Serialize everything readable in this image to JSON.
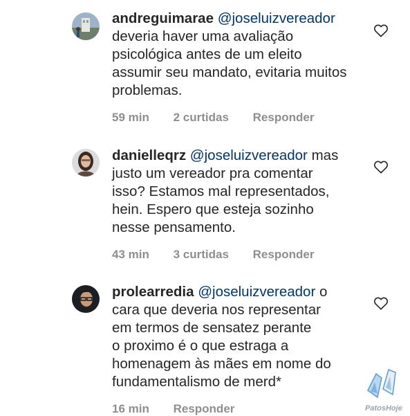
{
  "comments": [
    {
      "username": "andreguimarae",
      "mention": "@joseluizvereador",
      "lines": [
        " deveria haver uma avaliação",
        "psicológica antes de um eleito",
        "assumir seu mandato, evitaria muitos",
        "problemas."
      ],
      "time": "59 min",
      "likes": "2 curtidas",
      "reply": "Responder"
    },
    {
      "username": "danielleqrz",
      "mention": "@joseluizvereador",
      "first_tail": " mas",
      "lines": [
        "justo um vereador pra comentar",
        "isso? Estamos mal representados,",
        "hein. Espero que esteja sozinho",
        "nesse pensamento."
      ],
      "time": "43 min",
      "likes": "3 curtidas",
      "reply": "Responder"
    },
    {
      "username": "prolearredia",
      "mention": "@joseluizvereador",
      "first_tail": " o",
      "lines": [
        "cara que deveria nos representar",
        "em termos de sensatez perante",
        "o proximo é o que estraga a",
        "homenagem às mães em nome do",
        "fundamentalismo de merd*"
      ],
      "time": "16 min",
      "reply": "Responder"
    }
  ],
  "icons": {
    "like": "heart-outline-icon"
  },
  "watermark": {
    "label": "PatosHoje",
    "colors": [
      "#b9d7ee",
      "#5b9bd5",
      "#e6eef5"
    ]
  },
  "colors": {
    "text": "#262626",
    "mention": "#00376b",
    "meta": "#8e8e8e"
  }
}
